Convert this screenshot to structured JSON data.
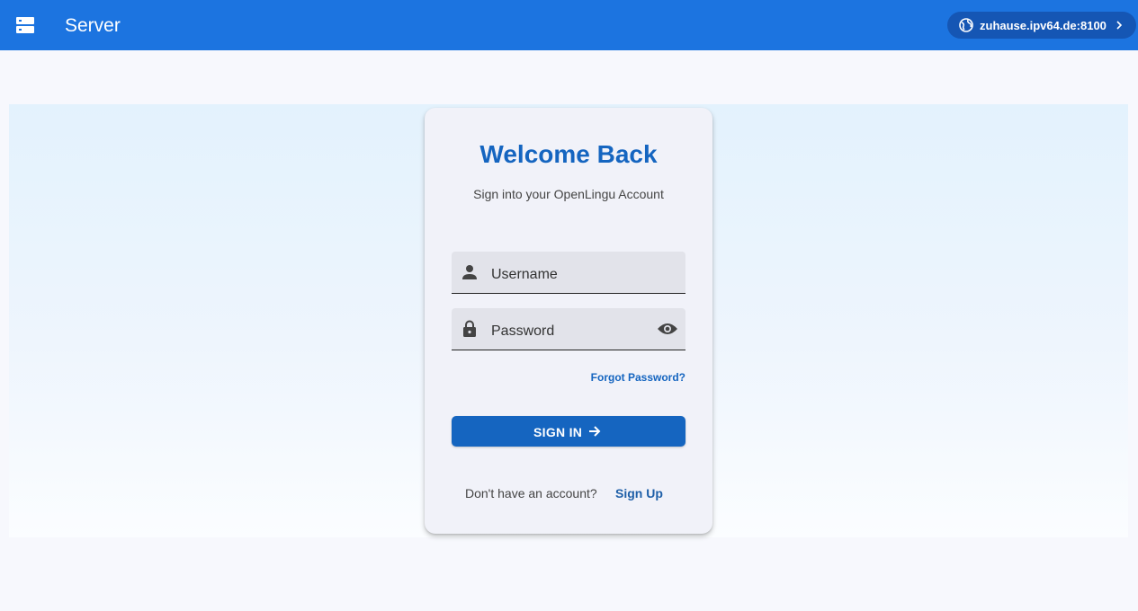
{
  "app": {
    "title": "Server"
  },
  "header": {
    "menu_icon": "dns-icon",
    "server_chip": {
      "label": "zuhause.ipv64.de:8100",
      "icon": "globe-icon",
      "chevron": "chevron-right-icon"
    }
  },
  "login": {
    "heading": "Welcome Back",
    "subheading": "Sign into your OpenLingu Account",
    "username": {
      "placeholder": "Username",
      "value": "",
      "icon": "person-icon"
    },
    "password": {
      "placeholder": "Password",
      "value": "",
      "icon": "lock-icon",
      "toggle_icon": "eye-icon"
    },
    "forgot_label": "Forgot Password?",
    "signin_label": "SIGN IN",
    "no_account_text": "Don't have an account?",
    "signup_label": "Sign Up"
  },
  "colors": {
    "appbar": "#1c74e0",
    "chip": "#1556b4",
    "primary": "#1565c0",
    "card": "#f1f2f9",
    "field": "#e2e3ea"
  }
}
